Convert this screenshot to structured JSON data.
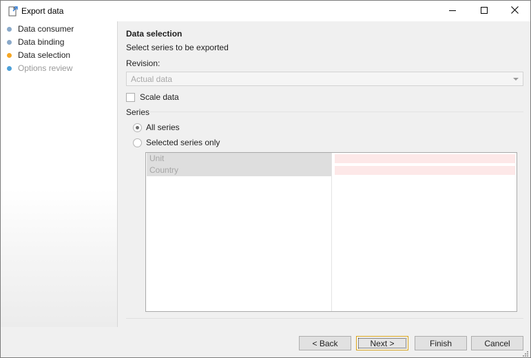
{
  "window": {
    "title": "Export data",
    "icon": "export-doc-icon",
    "controls": [
      "minimize-icon",
      "maximize-icon",
      "close-icon"
    ]
  },
  "sidebar": {
    "steps": [
      {
        "label": "Data consumer",
        "state": "done",
        "dot_color": "#8aa9c9"
      },
      {
        "label": "Data binding",
        "state": "done",
        "dot_color": "#8aa9c9"
      },
      {
        "label": "Data selection",
        "state": "current",
        "dot_color": "#f5a623"
      },
      {
        "label": "Options review",
        "state": "pending",
        "dot_color": "#4da0d8"
      }
    ]
  },
  "main": {
    "heading": "Data selection",
    "subheading": "Select series to be exported",
    "revision": {
      "label": "Revision:",
      "value": "Actual data"
    },
    "scale_data": {
      "label": "Scale data",
      "checked": false
    },
    "series": {
      "label": "Series",
      "options": [
        {
          "label": "All series",
          "checked": true
        },
        {
          "label": "Selected series only",
          "checked": false
        }
      ],
      "grid_rows": [
        {
          "name": "Unit",
          "value": ""
        },
        {
          "name": "Country",
          "value": ""
        }
      ]
    }
  },
  "footer": {
    "back": "< Back",
    "next": "Next >",
    "finish": "Finish",
    "cancel": "Cancel"
  },
  "colors": {
    "accent_current": "#f5a623",
    "pending_dot": "#4da0d8",
    "done_dot": "#8aa9c9",
    "invalid_cell": "#fde8e8"
  }
}
